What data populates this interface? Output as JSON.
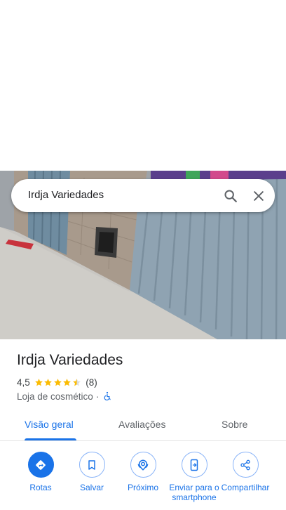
{
  "search": {
    "query": "Irdja Variedades"
  },
  "place": {
    "name": "Irdja Variedades",
    "rating": "4,5",
    "stars": 4.5,
    "review_count": "(8)",
    "category": "Loja de cosmético",
    "separator": "·",
    "accessible": true
  },
  "tabs": [
    {
      "label": "Visão geral",
      "active": true
    },
    {
      "label": "Avaliações",
      "active": false
    },
    {
      "label": "Sobre",
      "active": false
    }
  ],
  "actions": [
    {
      "label": "Rotas",
      "icon": "directions-icon"
    },
    {
      "label": "Salvar",
      "icon": "bookmark-icon"
    },
    {
      "label": "Próximo",
      "icon": "nearby-icon"
    },
    {
      "label": "Enviar para o smartphone",
      "icon": "send-to-phone-icon"
    },
    {
      "label": "Compartilhar",
      "icon": "share-icon"
    }
  ],
  "colors": {
    "accent": "#1a73e8",
    "star": "#fbbc04",
    "text_primary": "#202124",
    "text_secondary": "#5f6368"
  }
}
